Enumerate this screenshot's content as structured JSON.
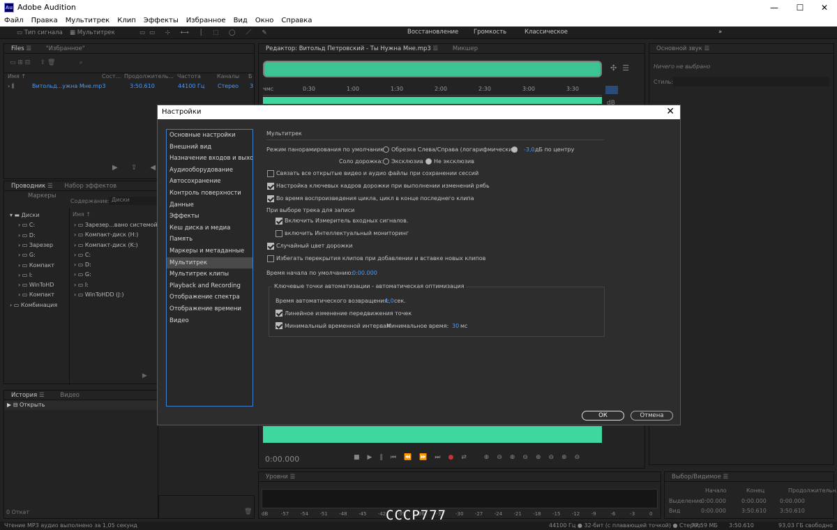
{
  "app": {
    "title": "Adobe Audition",
    "logo": "Au"
  },
  "menu": [
    "Файл",
    "Правка",
    "Мультитрек",
    "Клип",
    "Эффекты",
    "Избранное",
    "Вид",
    "Окно",
    "Справка"
  ],
  "toolbar": {
    "waveform_label": "Тип сигнала",
    "multitrack_label": "Мультитрек",
    "workspaces": [
      "Восстановление",
      "Громкость",
      "Классическое"
    ]
  },
  "files_panel": {
    "tabs": [
      "Files",
      "\"Избранное\""
    ],
    "columns": [
      "Имя ↑",
      "Сост...",
      "Продолжитель...",
      "Частота",
      "Каналы",
      "Б"
    ],
    "row": {
      "name": "Витольд...ужна Мне.mp3",
      "duration": "3:50.610",
      "rate": "44100 Гц",
      "channels": "Стерео",
      "bits": "3"
    }
  },
  "editor": {
    "tab": "Редактор: Витольд Петровский - Ты Нужна Мне.mp3",
    "mixer_tab": "Микшер",
    "timeline": [
      "чмс",
      "0:30",
      "1:00",
      "1:30",
      "2:00",
      "2:30",
      "3:00",
      "3:30"
    ],
    "db_label": "dB",
    "time": "0:00.000"
  },
  "essential": {
    "title": "Основной звук",
    "nothing": "Ничего не выбрано",
    "style_label": "Стиль:"
  },
  "browser": {
    "tabs": [
      "Проводник",
      "Набор эффектов",
      "Маркеры"
    ],
    "content_label": "Содержание:",
    "content_value": "Диски",
    "col_name": "Имя ↑",
    "tree": [
      "Диски",
      "C:",
      "D:",
      "Зарезер",
      "G:",
      "Компакт",
      "I:",
      "WinToHD",
      "Компакт",
      "Комбинация"
    ],
    "list": [
      "Зарезер...вано системой",
      "Компакт-диск (H:)",
      "Компакт-диск (K:)",
      "C:",
      "D:",
      "G:",
      "I:",
      "WinToHDD (J:)"
    ]
  },
  "history": {
    "tabs": [
      "История",
      "Видео"
    ],
    "item": "Открыть",
    "undo": "0 Откат"
  },
  "levels": {
    "title": "Уровни",
    "scale": [
      "dB",
      "-57",
      "-54",
      "-51",
      "-48",
      "-45",
      "-42",
      "-39",
      "-36",
      "-33",
      "-30",
      "-27",
      "-24",
      "-21",
      "-18",
      "-15",
      "-12",
      "-9",
      "-6",
      "-3",
      "0"
    ]
  },
  "selection": {
    "title": "Выбор/Видимое",
    "cols": [
      "Начало",
      "Конец",
      "Продолжительн..."
    ],
    "rows": [
      {
        "label": "Выделение",
        "vals": [
          "0:00.000",
          "0:00.000",
          "0:00.000"
        ]
      },
      {
        "label": "Вид",
        "vals": [
          "0:00.000",
          "3:50.610",
          "3:50.610"
        ]
      }
    ]
  },
  "statusbar": {
    "left": "Чтение MP3 аудио выполнено за 1,05 секунд",
    "format": "44100 Гц ● 32-бит (с плавающей точкой) ● Стерео",
    "size": "77,59 МБ",
    "duration": "3:50.610",
    "free": "93,03 ГБ свободно"
  },
  "watermark": "CCCP777",
  "dialog": {
    "title": "Настройки",
    "categories": [
      "Основные настройки",
      "Внешний вид",
      "Назначение входов и выходов",
      "Аудиооборудование",
      "Автосохранение",
      "Контроль поверхности",
      "Данные",
      "Эффекты",
      "Кеш диска и медиа",
      "Память",
      "Маркеры и метаданные",
      "Мультитрек",
      "Мультитрек клипы",
      "Playback and Recording",
      "Отображение спектра",
      "Отображение времени",
      "Видео"
    ],
    "selected_index": 11,
    "section": "Мультитрек",
    "pan_mode_label": "Режим панорамирования по умолчанию:",
    "pan_option1": "Обрезка Слева/Справа (логарифмический)",
    "pan_option2_value": "-3,0",
    "pan_option2_suffix": "дБ по центру",
    "solo_label": "Соло дорожка:",
    "solo_option1": "Эксклюзив",
    "solo_option2": "Не эксклюзив",
    "cb_link": "Связать все открытые видео и аудио файлы при сохранении сессий",
    "cb_keyframes": "Настройка ключевых кадров дорожки при выполнении изменений рябь",
    "cb_loop": "Во время воспроизведения цикла, цикл в конце последнего клипа",
    "record_label": "При выборе трека для записи",
    "cb_meter": "Включить Измеритель входных сигналов.",
    "cb_smart": "включить Интеллектуальный мониторинг",
    "cb_color": "Случайный цвет дорожки",
    "cb_overlap": "Избегать перекрытия клипов при добавлении и вставке новых клипов",
    "start_label": "Время начала по умолчанию:",
    "start_value": "0:00.000",
    "auto_group": "Ключевые точки автоматизации - автоматическая оптимизация",
    "return_label": "Время автоматического возвращения:",
    "return_value": "1,0",
    "return_unit": "сек.",
    "cb_linear": "Линейное изменение передвижения точек",
    "cb_min": "Минимальный временной интервал",
    "min_time_label": "Минимальное время:",
    "min_time_value": "30",
    "min_time_unit": "мс",
    "ok": "ОК",
    "cancel": "Отмена"
  }
}
